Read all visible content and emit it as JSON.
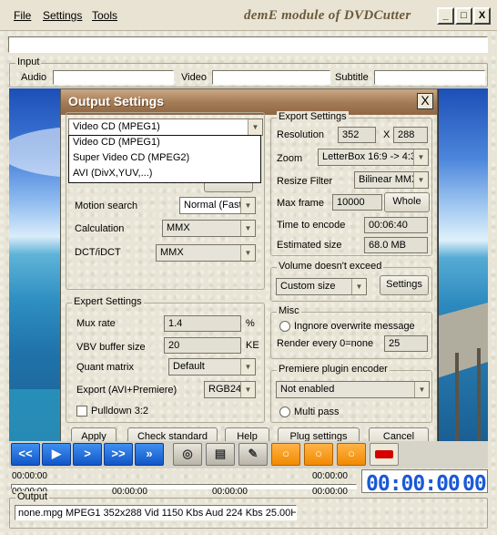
{
  "menu": {
    "file": "File",
    "settings": "Settings",
    "tools": "Tools"
  },
  "window": {
    "title": "demE module of DVDCutter",
    "min": "_",
    "max": "□",
    "close": "X"
  },
  "input_group": {
    "label": "Input",
    "audio_label": "Audio",
    "video_label": "Video",
    "subtitle_label": "Subtitle"
  },
  "dialog": {
    "title": "Output Settings",
    "close": "X",
    "format_combo": "Video CD (MPEG1)",
    "format_options": [
      "Video CD (MPEG1)",
      "Super Video CD (MPEG2)",
      "AVI (DivX,YUV,...)"
    ],
    "motion_search_label": "Motion search",
    "motion_search_value": "Normal (Fast)",
    "calculation_label": "Calculation",
    "calculation_value": "MMX",
    "dct_label": "DCT/iDCT",
    "dct_value": "MMX",
    "export_settings": {
      "legend": "Export Settings",
      "resolution_label": "Resolution",
      "res_w": "352",
      "res_x": "X",
      "res_h": "288",
      "zoom_label": "Zoom",
      "zoom_value": "LetterBox 16:9 -> 4:3",
      "resize_label": "Resize Filter",
      "resize_value": "Bilinear MMX",
      "maxframe_label": "Max frame",
      "maxframe_value": "10000",
      "whole_button": "Whole",
      "time_label": "Time to encode",
      "time_value": "00:06:40",
      "size_label": "Estimated size",
      "size_value": "68.0 MB"
    },
    "volume": {
      "legend": "Volume doesn't exceed",
      "value": "Custom size",
      "settings_button": "Settings"
    },
    "expert": {
      "legend": "Expert Settings",
      "mux_label": "Mux rate",
      "mux_value": "1.4",
      "mux_unit": "%",
      "vbv_label": "VBV buffer size",
      "vbv_value": "20",
      "vbv_unit": "KE",
      "quant_label": "Quant matrix",
      "quant_value": "Default",
      "export_label": "Export (AVI+Premiere)",
      "export_value": "RGB24",
      "pulldown_label": "Pulldown 3:2"
    },
    "misc": {
      "legend": "Misc",
      "ignore_label": "Ingnore overwrite message",
      "render_label": "Render every 0=none",
      "render_value": "25"
    },
    "premiere": {
      "legend": "Premiere plugin encoder",
      "value": "Not enabled",
      "multipass_label": "Multi pass"
    },
    "buttons": {
      "apply": "Apply",
      "check": "Check standard",
      "help": "Help",
      "plug": "Plug settings",
      "cancel": "Cancel"
    }
  },
  "transport": {
    "rewind": "<<",
    "play": "▶",
    "next": ">",
    "ffwd": ">>",
    "step": "»"
  },
  "times": {
    "t1": "00:00:00",
    "t2": "00:00:00",
    "t3": "00:00:00",
    "t4": "00:00:00",
    "t5": "00:00:00",
    "t6": "00:00:00"
  },
  "led": {
    "main": "00:00:00",
    "small": "00"
  },
  "output": {
    "label": "Output",
    "text": "none.mpg MPEG1 352x288 Vid 1150 Kbs Aud 224 Kbs 25.00Hz"
  }
}
